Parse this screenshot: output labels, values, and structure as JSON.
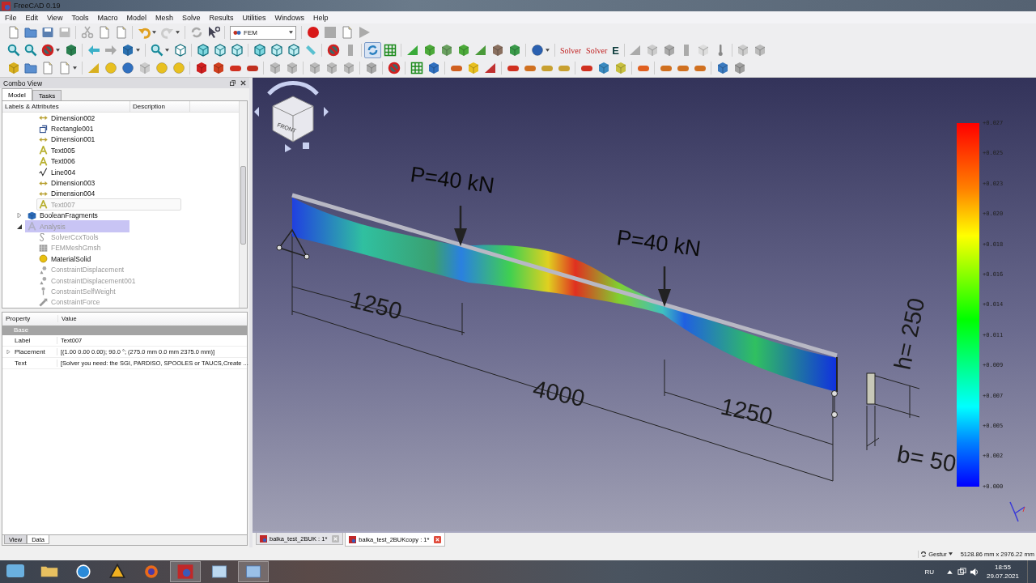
{
  "window": {
    "title": "FreeCAD 0.19"
  },
  "menu": [
    "File",
    "Edit",
    "View",
    "Tools",
    "Macro",
    "Model",
    "Mesh",
    "Solve",
    "Results",
    "Utilities",
    "Windows",
    "Help"
  ],
  "toolbar": {
    "workbench": "FEM",
    "solver_labels": [
      "Solver",
      "Solver",
      "E"
    ]
  },
  "combo_view": {
    "title": "Combo View",
    "tabs": [
      {
        "label": "Model",
        "selected": true
      },
      {
        "label": "Tasks",
        "selected": false
      }
    ],
    "tree": {
      "columns": [
        "Labels & Attributes",
        "Description"
      ],
      "continued": [
        {
          "label": "Dimension002",
          "kind": "dimension",
          "hidden": false,
          "selected": false,
          "current": false
        },
        {
          "label": "Rectangle001",
          "kind": "rectangle",
          "hidden": false,
          "selected": false,
          "current": false
        },
        {
          "label": "Dimension001",
          "kind": "dimension",
          "hidden": false,
          "selected": false,
          "current": false
        },
        {
          "label": "Text005",
          "kind": "text",
          "hidden": false,
          "selected": false,
          "current": false
        },
        {
          "label": "Text006",
          "kind": "text",
          "hidden": false,
          "selected": false,
          "current": false
        },
        {
          "label": "Line004",
          "kind": "line",
          "hidden": false,
          "selected": false,
          "current": false
        },
        {
          "label": "Dimension003",
          "kind": "dimension",
          "hidden": false,
          "selected": false,
          "current": false
        },
        {
          "label": "Dimension004",
          "kind": "dimension",
          "hidden": false,
          "selected": false,
          "current": false
        },
        {
          "label": "Text007",
          "kind": "text",
          "hidden": true,
          "selected": false,
          "current": true
        }
      ],
      "items": [
        {
          "label": "BooleanFragments",
          "kind": "part",
          "hidden": false,
          "selected": false,
          "current": false,
          "expanded": false
        },
        {
          "label": "Analysis",
          "kind": "analysis",
          "hidden": true,
          "selected": true,
          "current": false,
          "expanded": true,
          "children": [
            {
              "label": "SolverCcxTools",
              "kind": "solver",
              "hidden": true,
              "selected": false,
              "current": false
            },
            {
              "label": "FEMMeshGmsh",
              "kind": "mesh",
              "hidden": true,
              "selected": false,
              "current": false
            },
            {
              "label": "MaterialSolid",
              "kind": "material",
              "hidden": false,
              "selected": false,
              "current": false
            },
            {
              "label": "ConstraintDisplacement",
              "kind": "constraint",
              "hidden": true,
              "selected": false,
              "current": false
            },
            {
              "label": "ConstraintDisplacement001",
              "kind": "constraint",
              "hidden": true,
              "selected": false,
              "current": false
            },
            {
              "label": "ConstraintSelfWeight",
              "kind": "weight",
              "hidden": true,
              "selected": false,
              "current": false
            },
            {
              "label": "ConstraintForce",
              "kind": "force",
              "hidden": true,
              "selected": false,
              "current": false
            }
          ]
        }
      ]
    }
  },
  "property_panel": {
    "columns": [
      "Property",
      "Value"
    ],
    "group": "Base",
    "rows": [
      {
        "name": "Label",
        "value": "Text007",
        "expandable": false
      },
      {
        "name": "Placement",
        "value": "[(1.00 0.00 0.00); 90.0 °; (275.0 mm  0.0 mm  2375.0 mm)]",
        "expandable": true
      },
      {
        "name": "Text",
        "value": "[Solver you need: the SGI, PARDISO, SPOOLES or TAUCS,Create ...",
        "expandable": false
      }
    ],
    "tabs": [
      {
        "label": "View",
        "selected": false
      },
      {
        "label": "Data",
        "selected": true
      }
    ]
  },
  "viewport": {
    "nav_cube_face": "FRONT",
    "labels": [
      {
        "text": "P=40 kN",
        "kind": "load"
      },
      {
        "text": "P=40 kN",
        "kind": "load"
      },
      {
        "text": "1250",
        "kind": "dimension"
      },
      {
        "text": "4000",
        "kind": "dimension"
      },
      {
        "text": "1250",
        "kind": "dimension"
      },
      {
        "text": "h= 250",
        "kind": "dimension"
      },
      {
        "text": "b= 50",
        "kind": "dimension"
      }
    ],
    "legend": [
      "+0.027",
      "+0.025",
      "+0.023",
      "+0.020",
      "+0.018",
      "+0.016",
      "+0.014",
      "+0.011",
      "+0.009",
      "+0.007",
      "+0.005",
      "+0.002",
      "+0.000"
    ]
  },
  "document_tabs": [
    {
      "label": "balka_test_2BUK : 1*",
      "selected": false
    },
    {
      "label": "balka_test_2BUKcopy : 1*",
      "selected": true
    }
  ],
  "status_bar": {
    "navigation": "Gestur",
    "dimensions": "5128.86 mm x 2976.22 mm"
  },
  "taskbar": {
    "language": "RU",
    "time": "18:55",
    "date": "29.07.2021"
  }
}
